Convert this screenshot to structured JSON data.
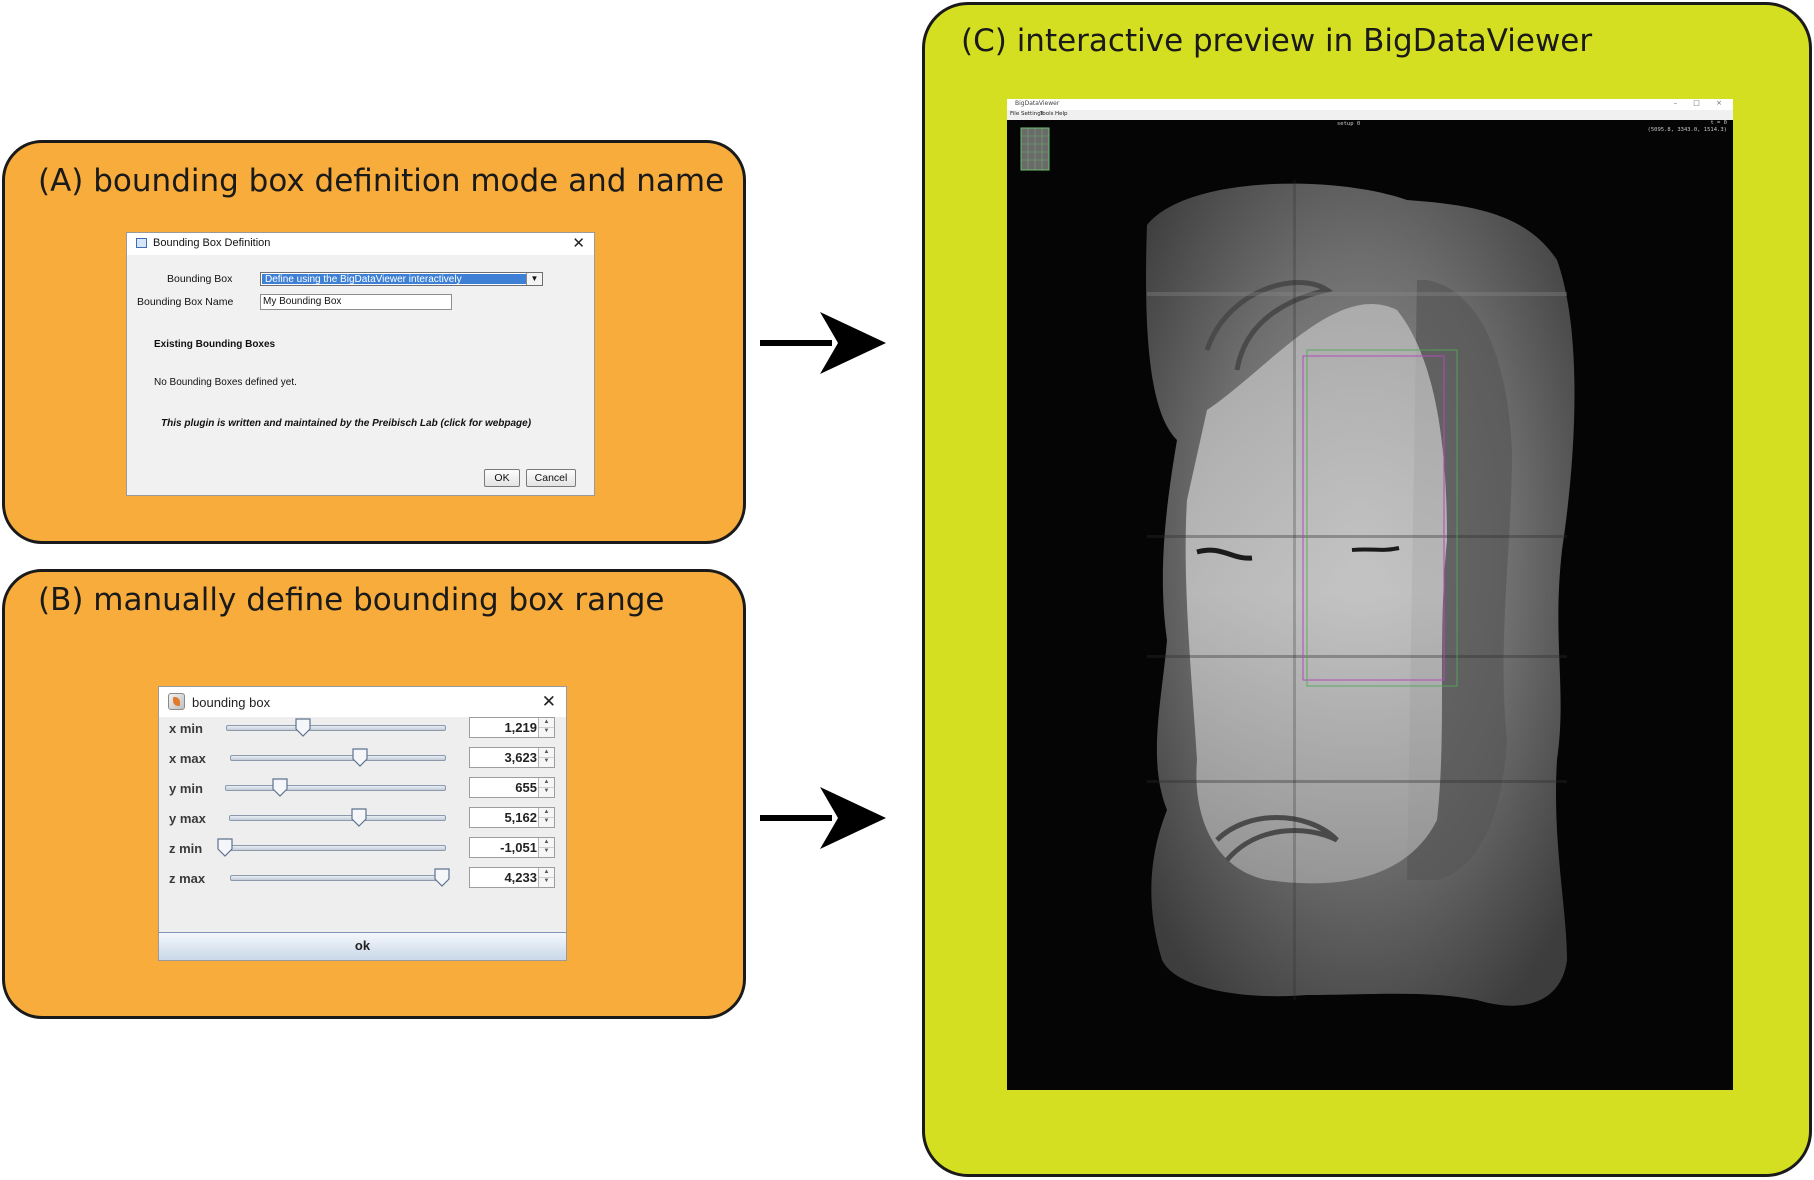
{
  "panel_a": {
    "title": "(A)  bounding box definition mode and name",
    "dialog": {
      "title": "Bounding Box Definition",
      "bounding_box_label": "Bounding Box",
      "bounding_box_value": "Define using the BigDataViewer interactively",
      "name_label": "Bounding Box Name",
      "name_value": "My Bounding Box",
      "existing_heading": "Existing Bounding Boxes",
      "existing_text": "No Bounding Boxes defined yet.",
      "plugin_note": "This plugin is written and maintained by the Preibisch Lab (click for webpage)",
      "ok_label": "OK",
      "cancel_label": "Cancel"
    }
  },
  "panel_b": {
    "title": "(B) manually define bounding box range",
    "dialog": {
      "title": "bounding box",
      "rows": [
        {
          "label": "x min",
          "value": "1,219",
          "level": 0.35
        },
        {
          "label": "x max",
          "value": "3,623",
          "level": 0.6
        },
        {
          "label": "y min",
          "value": "655",
          "level": 0.25
        },
        {
          "label": "y max",
          "value": "5,162",
          "level": 0.6
        },
        {
          "label": "z min",
          "value": "-1,051",
          "level": 0.0
        },
        {
          "label": "z max",
          "value": "4,233",
          "level": 1.0
        }
      ],
      "ok_label": "ok"
    }
  },
  "panel_c": {
    "title": "(C) interactive preview in BigDataViewer",
    "viewer": {
      "window_title": "BigDataViewer",
      "window_controls": "– □ ×",
      "menu": [
        "File",
        "Settings",
        "Tools",
        "Help"
      ],
      "source_name": "setup 0",
      "timepoint": "t = 0",
      "coordinates": "(5095.8, 3343.0, 1514.3)"
    }
  },
  "colors": {
    "panel_ab_fill": "#f7ac3c",
    "panel_c_fill": "#d5df22",
    "selection_blue": "#3d80d6",
    "bbox_magenta": "#b04ab8",
    "bbox_green": "#4fa85a"
  }
}
